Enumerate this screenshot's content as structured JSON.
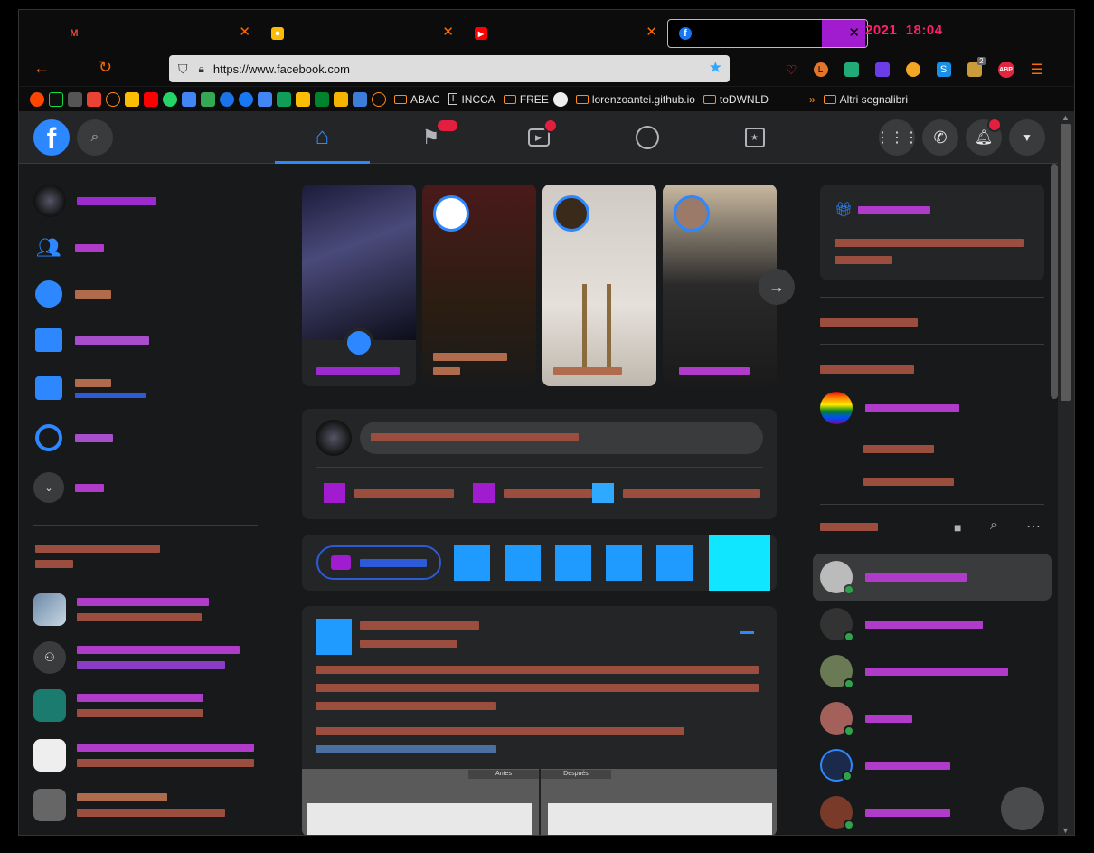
{
  "browser": {
    "tabs": [
      {
        "icon": "gmail-icon",
        "title": ""
      },
      {
        "icon": "keep-icon",
        "title": ""
      },
      {
        "icon": "youtube-icon",
        "title": ""
      },
      {
        "icon": "facebook-icon",
        "title": ""
      }
    ],
    "clock": {
      "year": "2021",
      "time": "18:04"
    },
    "url": "https://www.facebook.com",
    "bookmarks": {
      "folders": [
        "ABAC",
        "INCCA",
        "FREE",
        "lorenzoantei.github.io",
        "toDWNLD"
      ],
      "more": "Altri segnalibri",
      "adblock": "ABP",
      "ext_badge": "2"
    }
  },
  "facebook": {
    "top_nav": [
      "home",
      "pages",
      "watch",
      "groups",
      "gaming"
    ],
    "left_sections_hidden": true,
    "right_panel": {
      "contacts_count": 6
    },
    "post": {
      "before_label": "Antes",
      "after_label": "Después"
    }
  },
  "colors": {
    "accent": "#2d88ff",
    "badge": "#e41e3f",
    "page_bg": "#18191a",
    "card_bg": "#242526",
    "online": "#31a24c"
  }
}
